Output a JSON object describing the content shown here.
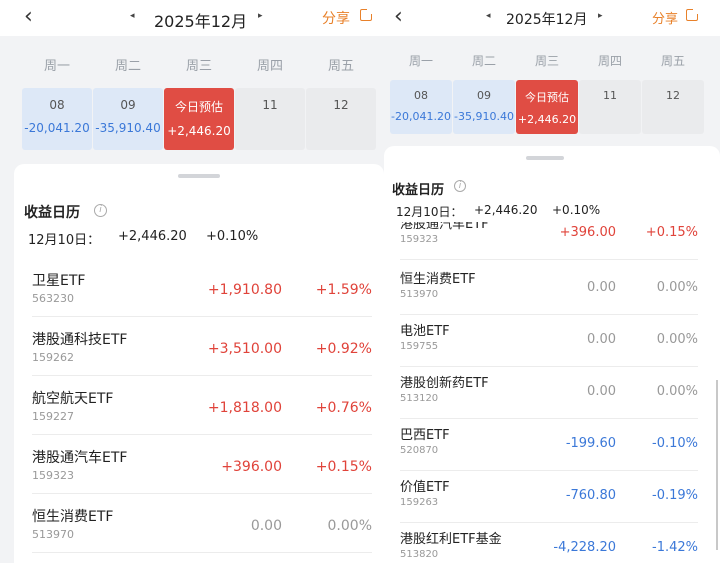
{
  "colors": {
    "accent": "#e8812a",
    "positive": "#e0433a",
    "negative": "#3b78d8",
    "today": "#e04d44"
  },
  "nav": {
    "back_icon": "chevron-left",
    "month": "2025年12月",
    "prev_icon": "◂",
    "next_icon": "▸",
    "share_label": "分享",
    "share_icon": "external-link"
  },
  "weekdays": [
    "周一",
    "周二",
    "周三",
    "周四",
    "周五"
  ],
  "days": [
    {
      "day": "08",
      "value": "-20,041.20",
      "style": "blue"
    },
    {
      "day": "09",
      "value": "-35,910.40",
      "style": "blue"
    },
    {
      "day": "今日预估",
      "value": "+2,446.20",
      "style": "red"
    },
    {
      "day": "11",
      "value": "",
      "style": "gray"
    },
    {
      "day": "12",
      "value": "",
      "style": "gray"
    }
  ],
  "section": {
    "title": "收益日历",
    "info_icon": "i",
    "date_label": "12月10日：",
    "total": "+2,446.20",
    "total_pct": "+0.10%"
  },
  "left_rows": [
    {
      "name": "卫星ETF",
      "code": "563230",
      "amount": "+1,910.80",
      "pct": "+1.59%",
      "sign": "pos"
    },
    {
      "name": "港股通科技ETF",
      "code": "159262",
      "amount": "+3,510.00",
      "pct": "+0.92%",
      "sign": "pos"
    },
    {
      "name": "航空航天ETF",
      "code": "159227",
      "amount": "+1,818.00",
      "pct": "+0.76%",
      "sign": "pos"
    },
    {
      "name": "港股通汽车ETF",
      "code": "159323",
      "amount": "+396.00",
      "pct": "+0.15%",
      "sign": "pos"
    },
    {
      "name": "恒生消费ETF",
      "code": "513970",
      "amount": "0.00",
      "pct": "0.00%",
      "sign": "zero"
    }
  ],
  "right_rows": [
    {
      "name": "港股通汽车ETF",
      "code": "159323",
      "amount": "+396.00",
      "pct": "+0.15%",
      "sign": "pos"
    },
    {
      "name": "恒生消费ETF",
      "code": "513970",
      "amount": "0.00",
      "pct": "0.00%",
      "sign": "zero"
    },
    {
      "name": "电池ETF",
      "code": "159755",
      "amount": "0.00",
      "pct": "0.00%",
      "sign": "zero"
    },
    {
      "name": "港股创新药ETF",
      "code": "513120",
      "amount": "0.00",
      "pct": "0.00%",
      "sign": "zero"
    },
    {
      "name": "巴西ETF",
      "code": "520870",
      "amount": "-199.60",
      "pct": "-0.10%",
      "sign": "neg"
    },
    {
      "name": "价值ETF",
      "code": "159263",
      "amount": "-760.80",
      "pct": "-0.19%",
      "sign": "neg"
    },
    {
      "name": "港股红利ETF基金",
      "code": "513820",
      "amount": "-4,228.20",
      "pct": "-1.42%",
      "sign": "neg"
    }
  ]
}
